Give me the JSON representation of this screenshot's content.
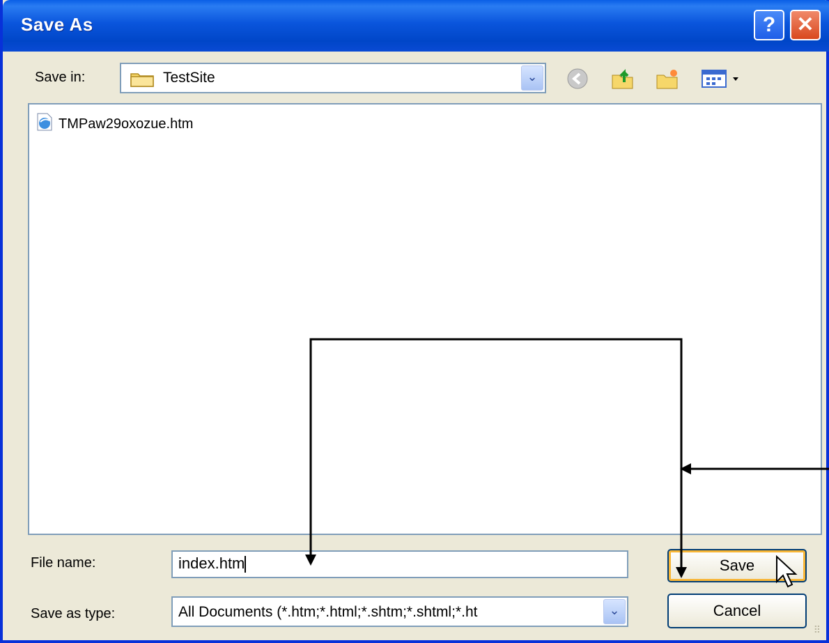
{
  "window": {
    "title": "Save As"
  },
  "titlebar": {
    "help_label": "?",
    "close_label": "✕"
  },
  "toolbar": {
    "save_in_label": "Save in:",
    "save_in_value": "TestSite",
    "icons": [
      "back-icon",
      "up-folder-icon",
      "new-folder-icon",
      "views-menu-icon"
    ]
  },
  "files": [
    {
      "name": "TMPaw29oxozue.htm",
      "icon": "html-document-icon"
    }
  ],
  "form": {
    "file_name_label": "File name:",
    "file_name_value": "index.htm",
    "save_type_label": "Save as type:",
    "save_type_value": "All Documents (*.htm;*.html;*.shtm;*.shtml;*.ht"
  },
  "buttons": {
    "save_label": "Save",
    "cancel_label": "Cancel"
  },
  "colors": {
    "title_blue": "#0a55dc",
    "dialog_bg": "#ece9d8",
    "field_border": "#7f9db9",
    "focus_orange": "#f8b636"
  }
}
